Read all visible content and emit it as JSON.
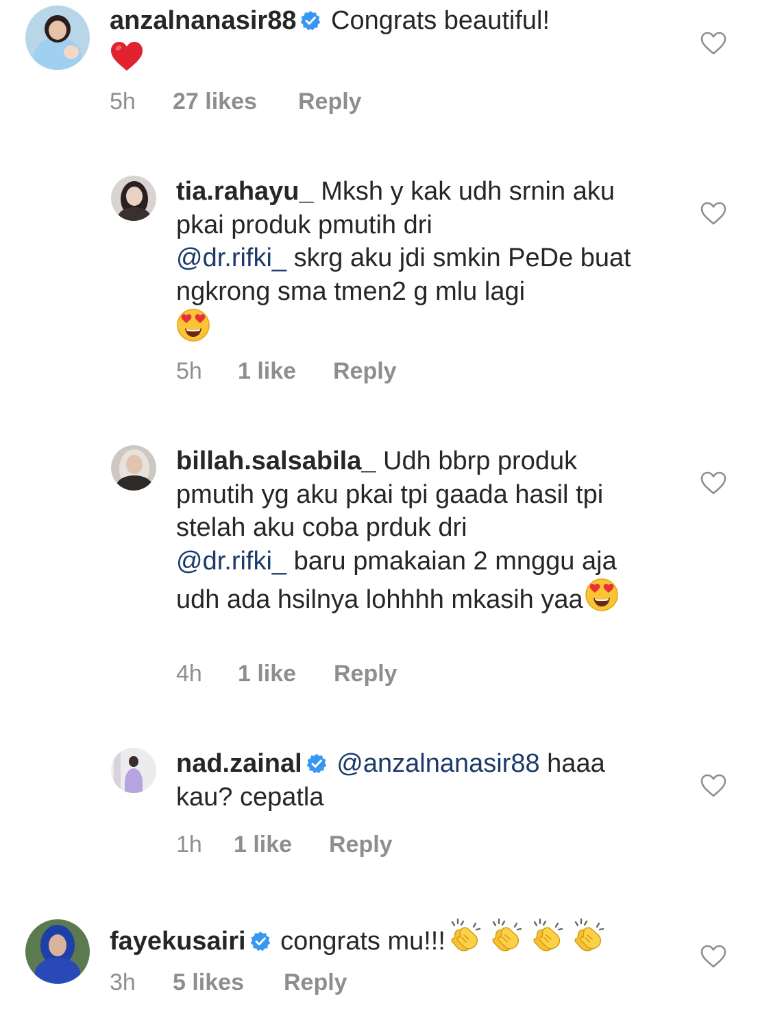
{
  "comments": [
    {
      "username": "anzalnanasir88",
      "verified": true,
      "text": "Congrats beautiful!",
      "emoji": "red-heart",
      "time": "5h",
      "likes": "27 likes",
      "reply_label": "Reply"
    },
    {
      "username": "tia.rahayu_",
      "verified": false,
      "text_part1": "Mksh y kak udh srnin aku pkai produk pmutih dri",
      "mention": "@dr.rifki_",
      "text_part2": "skrg aku jdi smkin PeDe buat ngkrong sma tmen2 g mlu lagi",
      "emoji": "heart-eyes",
      "time": "5h",
      "likes": "1 like",
      "reply_label": "Reply"
    },
    {
      "username": "billah.salsabila_",
      "verified": false,
      "text_part1": "Udh bbrp produk pmutih yg aku pkai tpi gaada hasil tpi stelah aku coba prduk dri",
      "mention": "@dr.rifki_",
      "text_part2": "baru pmakaian 2 mnggu aja udh ada hsilnya lohhhh mkasih yaa",
      "emoji": "heart-eyes",
      "time": "4h",
      "likes": "1 like",
      "reply_label": "Reply"
    },
    {
      "username": "nad.zainal",
      "verified": true,
      "mention": "@anzalnanasir88",
      "text": "haaa kau? cepatla",
      "time": "1h",
      "likes": "1 like",
      "reply_label": "Reply"
    },
    {
      "username": "fayekusairi",
      "verified": true,
      "text": "congrats mu!!!",
      "emoji": "clapping-hands",
      "time": "3h",
      "likes": "5 likes",
      "reply_label": "Reply"
    }
  ],
  "colors": {
    "text": "#262626",
    "meta": "#8e8e8e",
    "mention": "#1c3a68",
    "verified": "#3897f0"
  }
}
